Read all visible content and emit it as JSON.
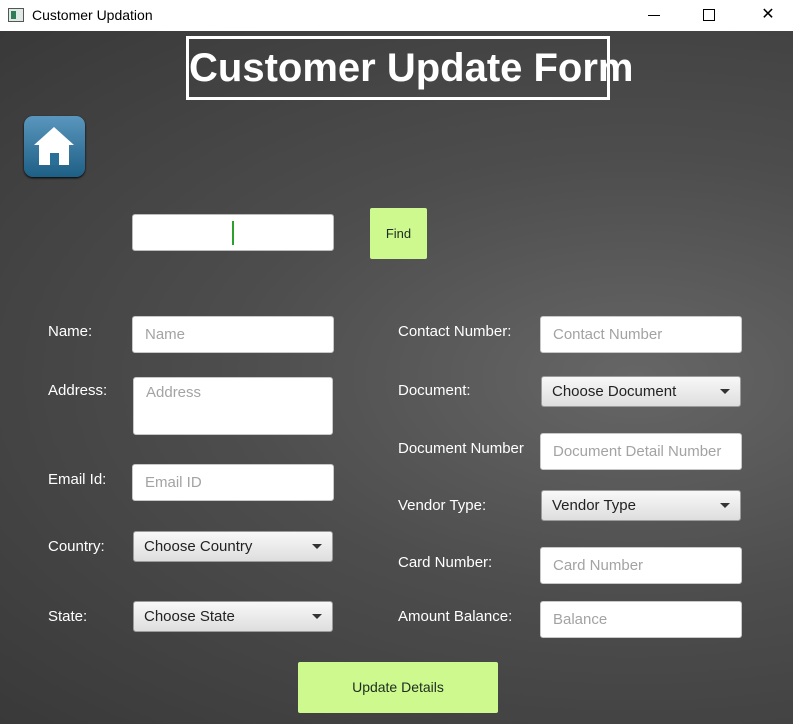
{
  "window": {
    "title": "Customer Updation",
    "minimize_glyph": "",
    "maximize_glyph": "",
    "close_glyph": "✕"
  },
  "header": {
    "title": "Customer Update Form"
  },
  "home_icon": "home-icon",
  "search": {
    "value": "",
    "find_label": "Find"
  },
  "left_form": {
    "name": {
      "label": "Name:",
      "placeholder": "Name"
    },
    "address": {
      "label": "Address:",
      "placeholder": "Address"
    },
    "email": {
      "label": "Email Id:",
      "placeholder": "Email ID"
    },
    "country": {
      "label": "Country:",
      "selected": "Choose Country"
    },
    "state": {
      "label": "State:",
      "selected": "Choose State"
    }
  },
  "right_form": {
    "contact": {
      "label": "Contact Number:",
      "placeholder": "Contact Number"
    },
    "document": {
      "label": "Document:",
      "selected": "Choose Document"
    },
    "document_number": {
      "label": "Document Number",
      "placeholder": "Document Detail Number"
    },
    "vendor": {
      "label": "Vendor Type:",
      "selected": "Vendor Type"
    },
    "card": {
      "label": "Card Number:",
      "placeholder": "Card Number"
    },
    "balance": {
      "label": "Amount Balance:",
      "placeholder": "Balance"
    }
  },
  "actions": {
    "update_label": "Update Details"
  },
  "colors": {
    "accent_button": "#cdf98f",
    "background": "#4d4d4d",
    "caret": "#2ca02c"
  }
}
